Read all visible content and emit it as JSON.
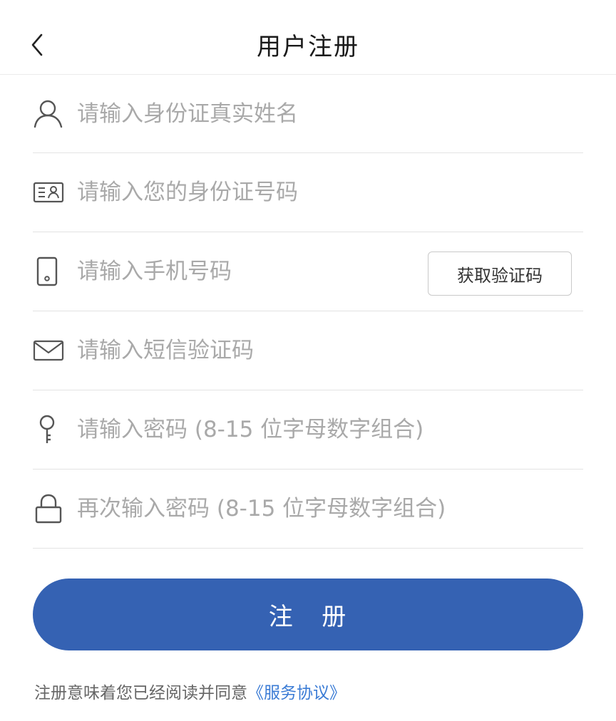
{
  "header": {
    "title": "用户注册",
    "back_icon": "chevron-left-icon"
  },
  "form": {
    "fields": [
      {
        "icon": "person-icon",
        "placeholder": "请输入身份证真实姓名"
      },
      {
        "icon": "id-card-icon",
        "placeholder": "请输入您的身份证号码"
      },
      {
        "icon": "phone-icon",
        "placeholder": "请输入手机号码"
      },
      {
        "icon": "envelope-icon",
        "placeholder": "请输入短信验证码"
      },
      {
        "icon": "key-icon",
        "placeholder": "请输入密码 (8-15 位字母数字组合)"
      },
      {
        "icon": "lock-icon",
        "placeholder": "再次输入密码 (8-15 位字母数字组合)"
      }
    ],
    "get_code_label": "获取验证码"
  },
  "submit": {
    "label": "注   册",
    "color": "#3562b3"
  },
  "agreement": {
    "text": "注册意味着您已经阅读并同意",
    "link": "《服务协议》",
    "link_color": "#3a7bd5"
  }
}
